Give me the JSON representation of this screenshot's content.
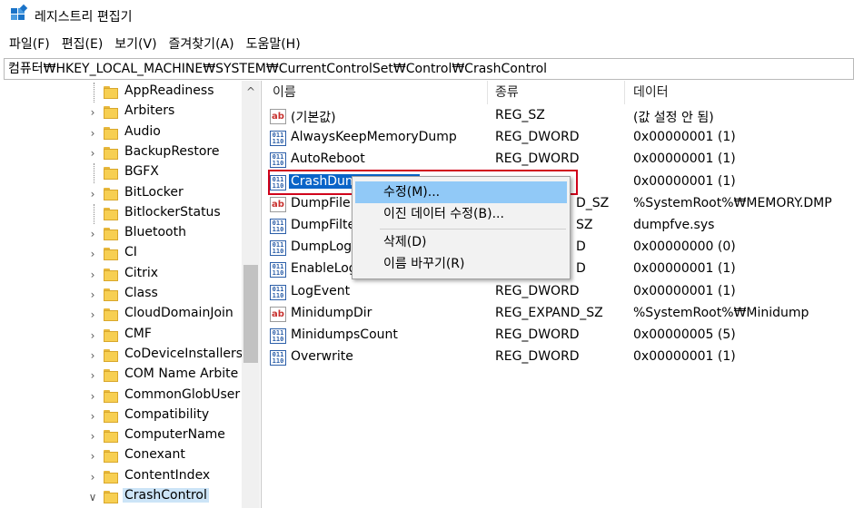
{
  "window": {
    "title": "레지스트리 편집기",
    "icon": "registry-editor-icon"
  },
  "menu": [
    "파일(F)",
    "편집(E)",
    "보기(V)",
    "즐겨찾기(A)",
    "도움말(H)"
  ],
  "address": "컴퓨터₩HKEY_LOCAL_MACHINE₩SYSTEM₩CurrentControlSet₩Control₩CrashControl",
  "tree": {
    "items": [
      {
        "label": "AppReadiness",
        "expander": "none"
      },
      {
        "label": "Arbiters",
        "expander": ">"
      },
      {
        "label": "Audio",
        "expander": ">"
      },
      {
        "label": "BackupRestore",
        "expander": ">"
      },
      {
        "label": "BGFX",
        "expander": "none"
      },
      {
        "label": "BitLocker",
        "expander": ">"
      },
      {
        "label": "BitlockerStatus",
        "expander": "none"
      },
      {
        "label": "Bluetooth",
        "expander": ">"
      },
      {
        "label": "CI",
        "expander": ">"
      },
      {
        "label": "Citrix",
        "expander": ">"
      },
      {
        "label": "Class",
        "expander": ">"
      },
      {
        "label": "CloudDomainJoin",
        "expander": ">"
      },
      {
        "label": "CMF",
        "expander": ">"
      },
      {
        "label": "CoDeviceInstallers",
        "expander": ">"
      },
      {
        "label": "COM Name Arbite",
        "expander": ">"
      },
      {
        "label": "CommonGlobUser",
        "expander": ">"
      },
      {
        "label": "Compatibility",
        "expander": ">"
      },
      {
        "label": "ComputerName",
        "expander": ">"
      },
      {
        "label": "Conexant",
        "expander": ">"
      },
      {
        "label": "ContentIndex",
        "expander": ">"
      },
      {
        "label": "CrashControl",
        "expander": "v",
        "selected": true
      }
    ],
    "scroll_up_glyph": "^"
  },
  "list": {
    "headers": {
      "name": "이름",
      "type": "종류",
      "data": "데이터"
    },
    "rows": [
      {
        "icon": "string-value-icon",
        "name": "(기본값)",
        "type": "REG_SZ",
        "data": "(값 설정 안 됨)"
      },
      {
        "icon": "binary-value-icon",
        "name": "AlwaysKeepMemoryDump",
        "type": "REG_DWORD",
        "data": "0x00000001 (1)"
      },
      {
        "icon": "binary-value-icon",
        "name": "AutoReboot",
        "type": "REG_DWORD",
        "data": "0x00000001 (1)"
      },
      {
        "icon": "binary-value-icon",
        "name": "CrashDumpEnabled",
        "name_visible": "CrashDun",
        "type": "",
        "data": "0x00000001 (1)",
        "selected": true
      },
      {
        "icon": "string-value-icon",
        "name": "DumpFile",
        "name_visible": "DumpFile",
        "type": "D_SZ",
        "data": "%SystemRoot%₩MEMORY.DMP"
      },
      {
        "icon": "binary-value-icon",
        "name": "DumpFilters",
        "name_visible": "DumpFilte",
        "type": "SZ",
        "data": "dumpfve.sys"
      },
      {
        "icon": "binary-value-icon",
        "name": "DumpLogLevel",
        "name_visible": "DumpLog",
        "type": "D",
        "data": "0x00000000 (0)"
      },
      {
        "icon": "binary-value-icon",
        "name": "EnableLogFile",
        "name_visible": "EnableLog",
        "type": "D",
        "data": "0x00000001 (1)"
      },
      {
        "icon": "binary-value-icon",
        "name": "LogEvent",
        "type": "REG_DWORD",
        "data": "0x00000001 (1)"
      },
      {
        "icon": "string-value-icon",
        "name": "MinidumpDir",
        "type": "REG_EXPAND_SZ",
        "data": "%SystemRoot%₩Minidump"
      },
      {
        "icon": "binary-value-icon",
        "name": "MinidumpsCount",
        "type": "REG_DWORD",
        "data": "0x00000005 (5)"
      },
      {
        "icon": "binary-value-icon",
        "name": "Overwrite",
        "type": "REG_DWORD",
        "data": "0x00000001 (1)"
      }
    ]
  },
  "context_menu": {
    "items": [
      {
        "label": "수정(M)...",
        "hover": true
      },
      {
        "label": "이진 데이터 수정(B)..."
      },
      {
        "label": "삭제(D)"
      },
      {
        "label": "이름 바꾸기(R)"
      }
    ]
  },
  "colors": {
    "selection": "#0a64c8",
    "hover": "#91c9f7",
    "highlight_box": "#d0021b",
    "folder": "#f7cf52"
  }
}
